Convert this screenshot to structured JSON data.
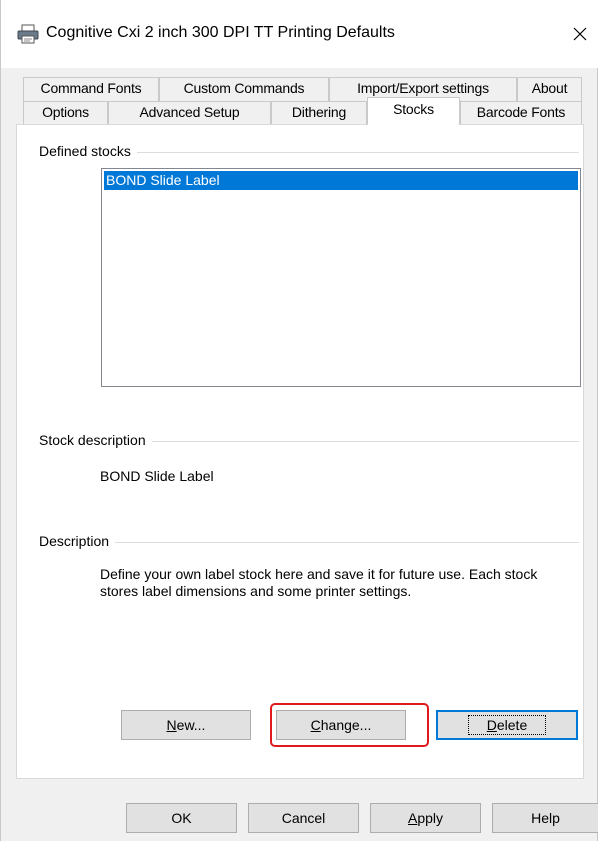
{
  "window": {
    "title": "Cognitive Cxi 2 inch 300 DPI TT Printing Defaults",
    "icon": "printer-icon",
    "close_icon": "close-icon"
  },
  "tabs": {
    "row_top": [
      "Command Fonts",
      "Custom Commands",
      "Import/Export settings",
      "About"
    ],
    "row_bottom": [
      "Options",
      "Advanced Setup",
      "Dithering",
      "Stocks",
      "Barcode Fonts"
    ],
    "active": "Stocks"
  },
  "stocks": {
    "defined_label": "Defined stocks",
    "items": [
      "BOND Slide Label"
    ],
    "selected": "BOND Slide Label",
    "stock_description_label": "Stock description",
    "stock_description_value": "BOND Slide Label",
    "description_label": "Description",
    "description_text": "Define your own label stock here and save it for future use. Each stock stores label dimensions and some printer settings."
  },
  "page_buttons": {
    "new": {
      "mnemonic": "N",
      "rest": "ew..."
    },
    "change": {
      "mnemonic": "C",
      "rest": "hange..."
    },
    "delete": {
      "mnemonic": "D",
      "rest": "elete"
    }
  },
  "dialog_buttons": {
    "ok": "OK",
    "cancel": "Cancel",
    "apply": {
      "mnemonic": "A",
      "rest": "pply"
    },
    "help": "Help"
  },
  "colors": {
    "selection": "#0078d7",
    "highlight_annotation": "#e0191d"
  }
}
